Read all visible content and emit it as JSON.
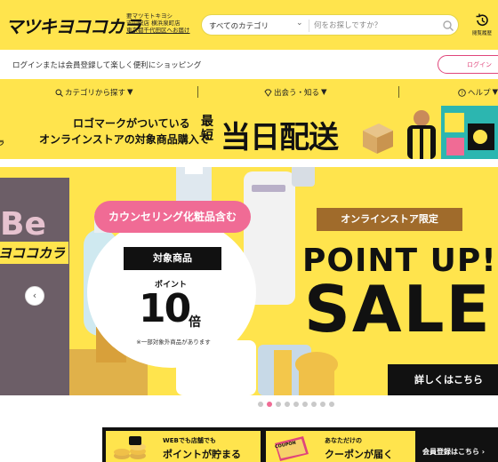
{
  "header": {
    "logo": "マツキヨココカラ",
    "store": {
      "line1": "要マツモトキヨシ",
      "line2": "吉川駅店 横浜泉町店",
      "line3": "東京都千代田区へお届け"
    },
    "search": {
      "category": "すべてのカテゴリ",
      "placeholder": "何をお探しですか？"
    },
    "history_label": "閲覧履歴"
  },
  "login_bar": {
    "text": "ログインまたは会員登録して楽しく便利にショッピング",
    "button": "ログイン"
  },
  "nav": {
    "items": [
      "カテゴリから探す",
      "出会う・知る",
      "ヘルプ"
    ]
  },
  "delivery_banner": {
    "line1": "ロゴマークがついている",
    "line2": "オンラインストアの対象商品購入で",
    "saitan": "最短",
    "big": "当日配送",
    "side_small": "ラ"
  },
  "hero": {
    "left_logo": "ヨココカラ",
    "left_partial": "Be",
    "pink_tag": "カウンセリング化粧品含む",
    "target": "対象商品",
    "point_label": "ポイント",
    "point_value": "10",
    "point_unit": "倍",
    "note": "※一部対象外商品があります",
    "online_tag": "オンラインストア限定",
    "point_up": "POINT UP!",
    "sale": "SALE",
    "details": "詳しくはこちら",
    "prev": "‹"
  },
  "carousel": {
    "count": 9,
    "active": 1
  },
  "promo": {
    "card1_small": "WEBでも店舗でも",
    "card1_big": "ポイントが貯まる",
    "card2_small": "あなただけの",
    "card2_big": "クーポンが届く",
    "register": "会員登録はこちら ›",
    "coupon_label": "COUPON"
  },
  "colors": {
    "brand_yellow": "#ffe44d",
    "accent_pink": "#e0457b",
    "black": "#111111"
  }
}
